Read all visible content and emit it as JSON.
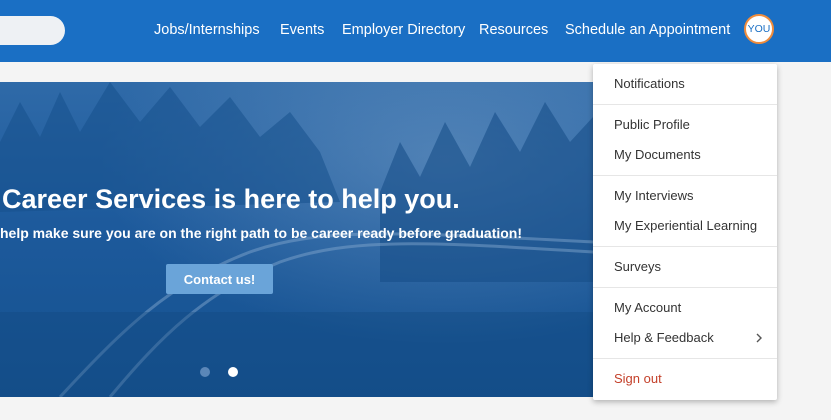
{
  "nav": {
    "items": [
      "Jobs/Internships",
      "Events",
      "Employer Directory",
      "Resources",
      "Schedule an Appointment"
    ],
    "avatar_text": "YOU"
  },
  "hero": {
    "title": "Career Services is here to help you.",
    "subtitle": "help make sure you are on the right path to be career ready before graduation!",
    "cta_label": "Contact us!",
    "active_slide": 2,
    "slide_count": 2
  },
  "menu": {
    "items": [
      {
        "label": "Notifications"
      },
      {
        "label": "Public Profile"
      },
      {
        "label": "My Documents"
      },
      {
        "label": "My Interviews"
      },
      {
        "label": "My Experiential Learning"
      },
      {
        "label": "Surveys"
      },
      {
        "label": "My Account"
      },
      {
        "label": "Help & Feedback"
      },
      {
        "label": "Sign out"
      }
    ]
  },
  "colors": {
    "topbar": "#1a6fc4",
    "hero": "#1d5a9c",
    "cta": "#6aa4d9",
    "sign_out": "#c4402a",
    "avatar_ring": "#f08c3c"
  },
  "icons": {
    "submenu": "chevron-right-icon"
  }
}
